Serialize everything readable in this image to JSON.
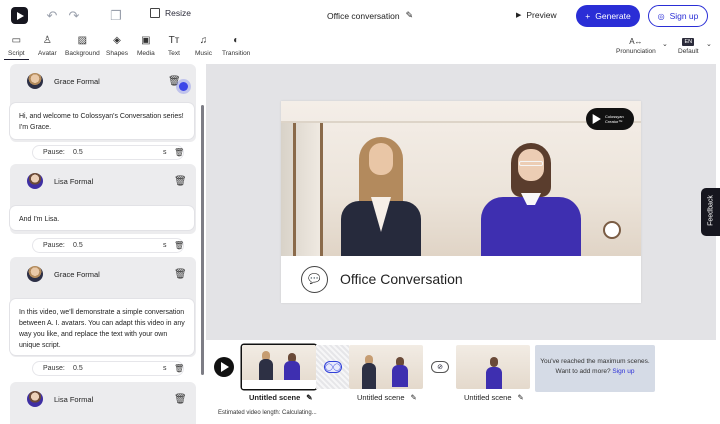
{
  "header": {
    "resize_label": "Resize",
    "title": "Office conversation",
    "preview_label": "Preview",
    "generate_label": "Generate",
    "signup_label": "Sign up"
  },
  "toolbar": {
    "items": [
      {
        "label": "Script",
        "icon": "script-icon"
      },
      {
        "label": "Avatar",
        "icon": "avatar-icon"
      },
      {
        "label": "Background",
        "icon": "background-icon"
      },
      {
        "label": "Shapes",
        "icon": "shapes-icon"
      },
      {
        "label": "Media",
        "icon": "media-icon"
      },
      {
        "label": "Text",
        "icon": "text-icon"
      },
      {
        "label": "Music",
        "icon": "music-icon"
      },
      {
        "label": "Transition",
        "icon": "transition-icon"
      }
    ],
    "pronunciation_label": "Pronunciation",
    "language_badge": "EN",
    "language_label": "Default"
  },
  "script": {
    "blocks": [
      {
        "speaker": "Grace Formal",
        "text": "Hi, and welcome to Colossyan's Conversation series!  I'm Grace.",
        "pause_label": "Pause:",
        "pause_value": "0.5",
        "pause_unit": "s"
      },
      {
        "speaker": "Lisa Formal",
        "text": "And I'm Lisa.",
        "pause_label": "Pause:",
        "pause_value": "0.5",
        "pause_unit": "s"
      },
      {
        "speaker": "Grace Formal",
        "text": "In this video,  we'll demonstrate a simple conversation between A. I. avatars.  You can adapt this video in any way you like, and replace the text with your own unique script.",
        "pause_label": "Pause:",
        "pause_value": "0.5",
        "pause_unit": "s"
      },
      {
        "speaker": "Lisa Formal"
      }
    ]
  },
  "slide": {
    "title": "Office Conversation",
    "brand_line1": "Colossyan",
    "brand_line2": "Creator™"
  },
  "feedback_label": "Feedback",
  "timeline": {
    "scenes": [
      {
        "label": "Untitled scene"
      },
      {
        "label": "Untitled scene"
      },
      {
        "label": "Untitled scene"
      }
    ],
    "max_text": "You've reached the maximum scenes. Want to add more?",
    "max_link": "Sign up",
    "estimate": "Estimated video length: Calculating..."
  },
  "colors": {
    "accent": "#2a2ed6",
    "canvas_bg": "#e3e3e6",
    "max_box_bg": "#d5dbe6"
  }
}
